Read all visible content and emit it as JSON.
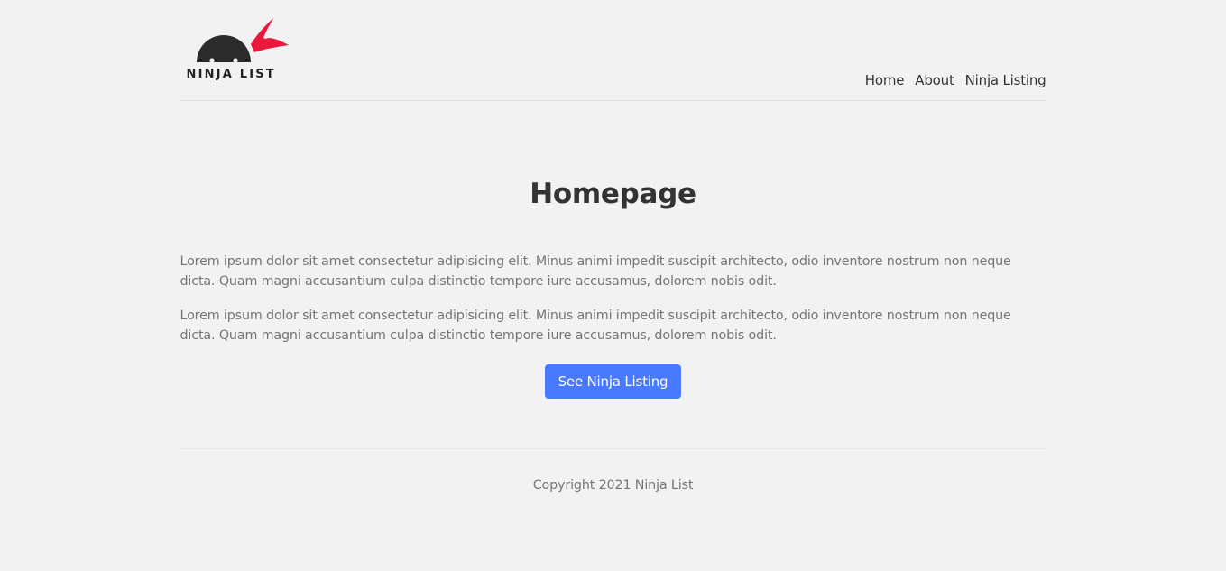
{
  "header": {
    "logo_text": "NINJA LIST",
    "nav": [
      {
        "label": "Home"
      },
      {
        "label": "About"
      },
      {
        "label": "Ninja Listing"
      }
    ]
  },
  "main": {
    "title": "Homepage",
    "paragraphs": [
      "Lorem ipsum dolor sit amet consectetur adipisicing elit. Minus animi impedit suscipit architecto, odio inventore nostrum non neque dicta. Quam magni accusantium culpa distinctio tempore iure accusamus, dolorem nobis odit.",
      "Lorem ipsum dolor sit amet consectetur adipisicing elit. Minus animi impedit suscipit architecto, odio inventore nostrum non neque dicta. Quam magni accusantium culpa distinctio tempore iure accusamus, dolorem nobis odit."
    ],
    "cta_label": "See Ninja Listing"
  },
  "footer": {
    "copyright": "Copyright 2021 Ninja List"
  },
  "colors": {
    "background": "#f2f2f2",
    "button": "#4979ff",
    "logo_headband": "#e8193c",
    "logo_head": "#2b2b2b"
  },
  "icons": {
    "logo": "ninja-head-logo-icon"
  }
}
